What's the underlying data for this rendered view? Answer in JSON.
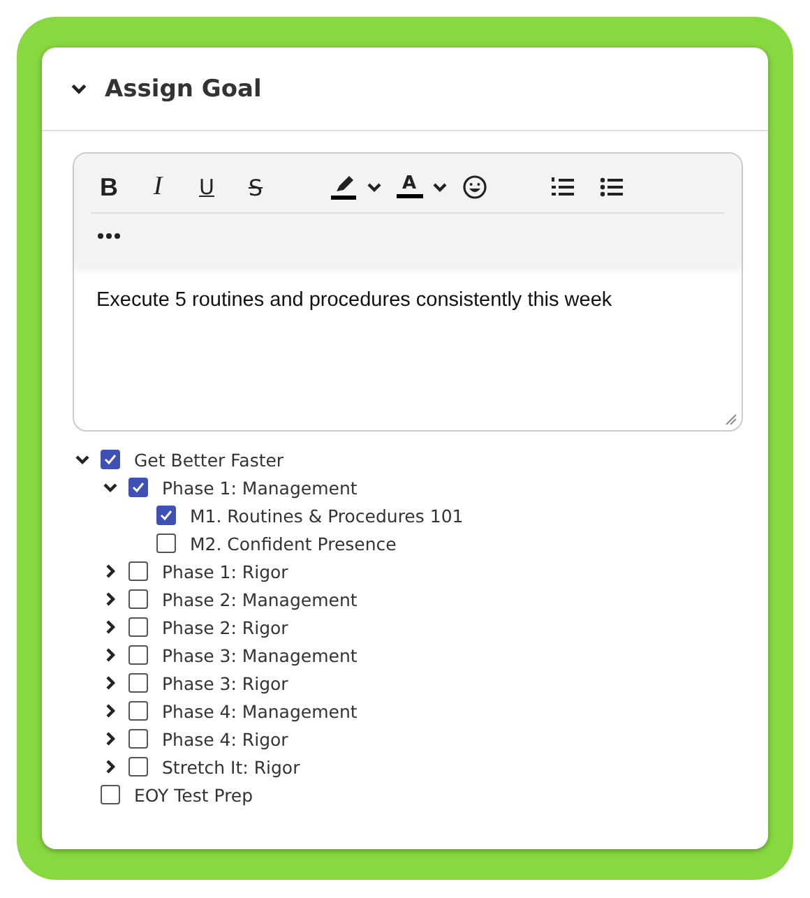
{
  "panel": {
    "title": "Assign Goal",
    "expanded": true
  },
  "toolbar": [
    {
      "kind": "bold",
      "label": "B"
    },
    {
      "kind": "italic",
      "label": "I"
    },
    {
      "kind": "underline",
      "label": "U"
    },
    {
      "kind": "strike",
      "label": "S"
    },
    {
      "kind": "highlight"
    },
    {
      "kind": "font-color",
      "label": "A"
    },
    {
      "kind": "emoji"
    },
    {
      "kind": "ordered-list"
    },
    {
      "kind": "bullet-list"
    },
    {
      "kind": "more"
    }
  ],
  "editor": {
    "value": "Execute 5 routines and procedures consistently this week"
  },
  "tree": [
    {
      "label": "Get Better Faster",
      "checked": true,
      "expanded": true,
      "children": [
        {
          "label": "Phase 1: Management",
          "checked": true,
          "expanded": true,
          "children": [
            {
              "label": "M1. Routines & Procedures 101",
              "checked": true
            },
            {
              "label": "M2. Confident Presence",
              "checked": false
            }
          ]
        },
        {
          "label": "Phase 1: Rigor",
          "checked": false,
          "expanded": false
        },
        {
          "label": "Phase 2: Management",
          "checked": false,
          "expanded": false
        },
        {
          "label": "Phase 2: Rigor",
          "checked": false,
          "expanded": false
        },
        {
          "label": "Phase 3: Management",
          "checked": false,
          "expanded": false
        },
        {
          "label": "Phase 3: Rigor",
          "checked": false,
          "expanded": false
        },
        {
          "label": "Phase 4: Management",
          "checked": false,
          "expanded": false
        },
        {
          "label": "Phase 4: Rigor",
          "checked": false,
          "expanded": false
        },
        {
          "label": "Stretch It: Rigor",
          "checked": false,
          "expanded": false
        }
      ]
    },
    {
      "label": "EOY Test Prep",
      "checked": false
    }
  ]
}
